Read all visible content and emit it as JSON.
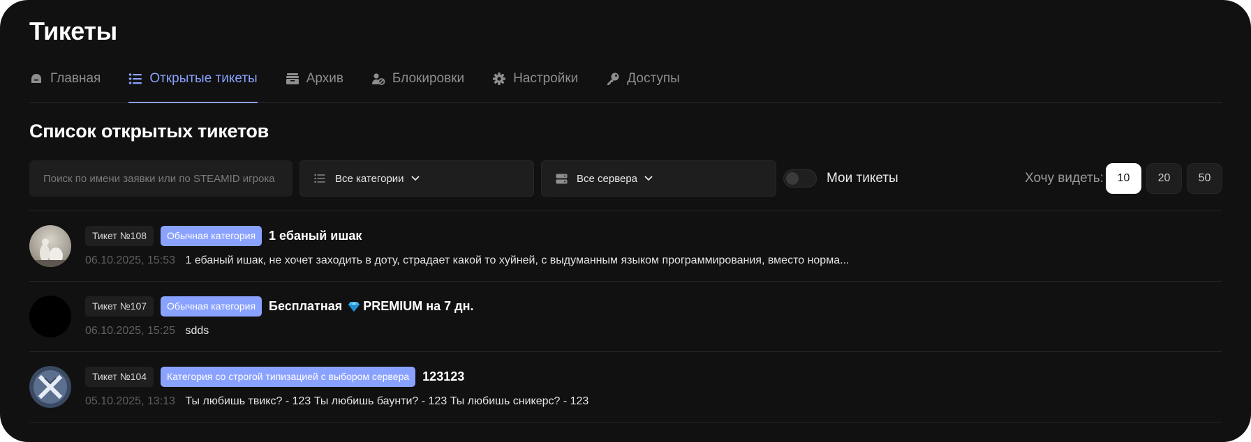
{
  "page_title": "Тикеты",
  "tabs": [
    {
      "label": "Главная",
      "icon": "home-icon",
      "active": false
    },
    {
      "label": "Открытые тикеты",
      "icon": "list-icon",
      "active": true
    },
    {
      "label": "Архив",
      "icon": "archive-icon",
      "active": false
    },
    {
      "label": "Блокировки",
      "icon": "user-block-icon",
      "active": false
    },
    {
      "label": "Настройки",
      "icon": "gear-icon",
      "active": false
    },
    {
      "label": "Доступы",
      "icon": "key-icon",
      "active": false
    }
  ],
  "section_title": "Список открытых тикетов",
  "filters": {
    "search_placeholder": "Поиск по имени заявки или по STEAMID игрока",
    "category_label": "Все категории",
    "server_label": "Все сервера",
    "my_tickets_label": "Мои тикеты",
    "my_tickets_on": false,
    "want_label": "Хочу видеть:",
    "page_sizes": [
      "10",
      "20",
      "50"
    ],
    "page_size_selected": "10"
  },
  "tickets": [
    {
      "number": "Тикет №108",
      "category": "Обычная категория",
      "title": "1 ебаный ишак",
      "date": "06.10.2025, 15:53",
      "text": "1 ебаный ишак, не хочет заходить в доту, страдает какой то хуйней, с выдуманным языком программирования, вместо норма..."
    },
    {
      "number": "Тикет №107",
      "category": "Обычная категория",
      "title_prefix": "Бесплатная",
      "title_icon": "gem-icon",
      "title_suffix": "PREMIUM на 7 дн.",
      "date": "06.10.2025, 15:25",
      "text": "sdds"
    },
    {
      "number": "Тикет №104",
      "category": "Категория со строгой типизацией с выбором сервера",
      "title": "123123",
      "date": "05.10.2025, 13:13",
      "text": "Ты любишь твикс? - 123 Ты любишь баунти? - 123 Ты любишь сникерс? - 123"
    }
  ],
  "colors": {
    "background": "#111111",
    "accent": "#8aa2ff",
    "muted": "#8e8e8e",
    "surface": "#1e1e1e"
  }
}
